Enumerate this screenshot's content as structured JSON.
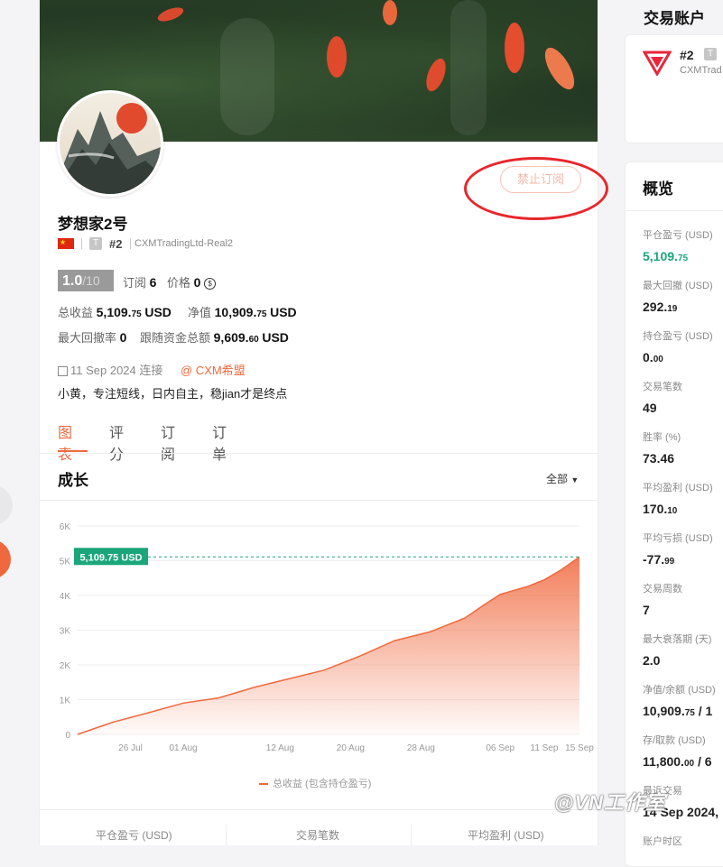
{
  "profile": {
    "name": "梦想家2号",
    "rank": "#2",
    "broker": "CXMTradingLtd-Real2",
    "subscribe_btn": "禁止订阅",
    "score": "1.0",
    "score_den": "/10",
    "subs_label": "订阅",
    "subs_value": "6",
    "price_label": "价格",
    "price_value": "0",
    "total_profit_label": "总收益",
    "total_profit_int": "5,109.",
    "total_profit_dec": "75",
    "net_label": "净值",
    "net_int": "10,909.",
    "net_dec": "75",
    "currency": "USD",
    "drawdown_label": "最大回撤率",
    "drawdown_value": "0",
    "follow_label": "跟随资金总额",
    "follow_int": "9,609.",
    "follow_dec": "60",
    "date": "11 Sep 2024 连接",
    "group": "@ CXM希盟",
    "bio": "小黄，专注短线，日内自主，稳jian才是终点"
  },
  "tabs": [
    "图表",
    "评分",
    "订阅",
    "订单"
  ],
  "chart_section": {
    "title": "成长",
    "range": "全部",
    "current_label": "5,109.75 USD",
    "legend": "总收益 (包含持仓盈亏)"
  },
  "chart_data": {
    "type": "area",
    "ylabel": "",
    "yticks": [
      "0",
      "1K",
      "2K",
      "3K",
      "4K",
      "5K",
      "6K"
    ],
    "ylim": [
      0,
      6000
    ],
    "xticks": [
      "26 Jul",
      "01 Aug",
      "12 Aug",
      "20 Aug",
      "28 Aug",
      "06 Sep",
      "11 Sep",
      "15 Sep"
    ],
    "series": [
      {
        "name": "总收益 (包含持仓盈亏)",
        "x": [
          "2024-07-20",
          "2024-07-24",
          "2024-07-28",
          "2024-08-01",
          "2024-08-05",
          "2024-08-09",
          "2024-08-13",
          "2024-08-17",
          "2024-08-21",
          "2024-08-25",
          "2024-08-29",
          "2024-09-02",
          "2024-09-04",
          "2024-09-06",
          "2024-09-09",
          "2024-09-11",
          "2024-09-13",
          "2024-09-15"
        ],
        "values": [
          0,
          350,
          620,
          900,
          1050,
          1350,
          1600,
          1850,
          2250,
          2700,
          2950,
          3350,
          3700,
          4030,
          4250,
          4450,
          4750,
          5109.75
        ]
      }
    ],
    "reference_line": 5109.75
  },
  "footer_labels": [
    "平仓盈亏 (USD)",
    "交易笔数",
    "平均盈利 (USD)"
  ],
  "account": {
    "title": "交易账户",
    "rank": "#2",
    "broker": "CXMTrad"
  },
  "overview": {
    "title": "概览",
    "items": [
      {
        "label": "平仓盈亏 (USD)",
        "int": "5,109.",
        "dec": "75",
        "green": true
      },
      {
        "label": "最大回撤 (USD)",
        "int": "292.",
        "dec": "19"
      },
      {
        "label": "持仓盈亏 (USD)",
        "int": "0.",
        "dec": "00"
      },
      {
        "label": "交易笔数",
        "int": "49",
        "dec": ""
      },
      {
        "label": "胜率 (%)",
        "int": "73.46",
        "dec": ""
      },
      {
        "label": "平均盈利 (USD)",
        "int": "170.",
        "dec": "10"
      },
      {
        "label": "平均亏损 (USD)",
        "int": "-77.",
        "dec": "99"
      },
      {
        "label": "交易周数",
        "int": "7",
        "dec": ""
      },
      {
        "label": "最大衰落期 (天)",
        "int": "2.0",
        "dec": ""
      },
      {
        "label": "净值/余额 (USD)",
        "int": "10,909.",
        "dec": "75",
        "suffix": " / 1"
      },
      {
        "label": "存/取款 (USD)",
        "int": "11,800.",
        "dec": "00",
        "suffix": " / 6"
      },
      {
        "label": "最近交易",
        "int": "14 Sep 2024,",
        "dec": ""
      },
      {
        "label": "账户时区",
        "int": "",
        "dec": ""
      }
    ]
  },
  "watermark": "@VN工作室",
  "colors": {
    "accent": "#f0683d",
    "green": "#1aa67a",
    "badge_green": "#1aa67a"
  }
}
